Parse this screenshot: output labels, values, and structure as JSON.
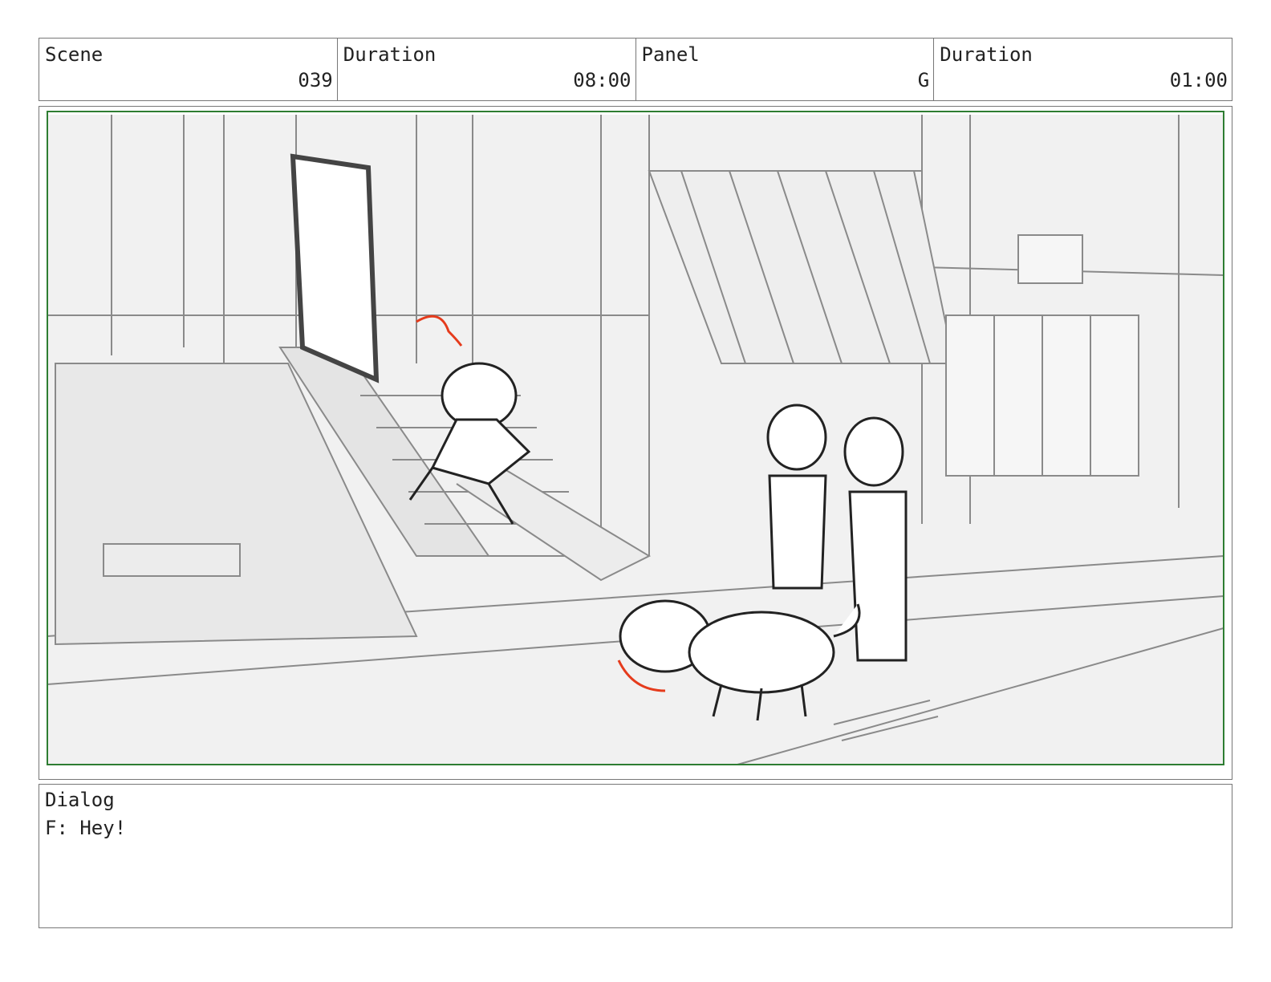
{
  "header": {
    "scene_label": "Scene",
    "scene_value": "039",
    "duration_label": "Duration",
    "duration_value": "08:00",
    "panel_label": "Panel",
    "panel_value": "G",
    "panel_duration_label": "Duration",
    "panel_duration_value": "01:00"
  },
  "dialog": {
    "label": "Dialog",
    "text": "F: Hey!"
  },
  "colors": {
    "safe_frame": "#2e7d32",
    "action_arrow": "#e53b1c",
    "line": "#777777"
  }
}
